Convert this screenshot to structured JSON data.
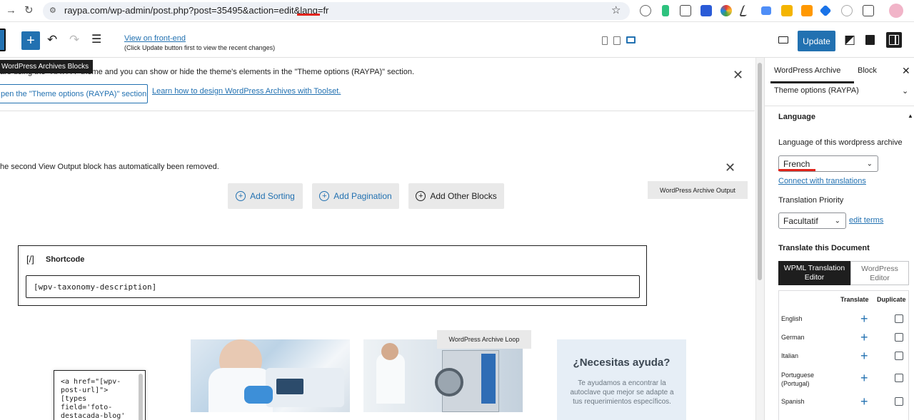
{
  "browser": {
    "url": "raypa.com/wp-admin/post.php?post=35495&action=edit&lang=fr"
  },
  "toolbar": {
    "view_front_end": "View on front-end",
    "view_hint": "(Click Update button first to view the recent changes)",
    "update_label": "Update",
    "tooltip": "WordPress Archives Blocks"
  },
  "notices": {
    "theme_text": "are using the \"RAYPA\" theme and you can show or hide the theme's elements in the \"Theme options (RAYPA)\" section.",
    "open_theme_options": "pen the \"Theme options (RAYPA)\" section",
    "learn_link": "Learn how to design WordPress Archives with Toolset.",
    "removed_text": "he second View Output block has automatically been removed."
  },
  "canvas": {
    "add_sorting": "Add Sorting",
    "add_pagination": "Add Pagination",
    "add_other": "Add Other Blocks",
    "output_label": "WordPress Archive Output",
    "loop_label": "WordPress Archive Loop",
    "shortcode_icon": "[/]",
    "shortcode_title": "Shortcode",
    "shortcode_value": "[wpv-taxonomy-description]",
    "code_snippet": "<a href=\"[wpv-\npost-url]\">\n[types\nfield='foto-\ndestacada-blog'",
    "help_title": "¿Necesitas ayuda?",
    "help_text": "Te ayudamos a encontrar la autoclave que mejor se adapte a tus requerimientos específicos."
  },
  "sidebar": {
    "tab_archive": "WordPress Archive",
    "tab_block": "Block",
    "theme_options": "Theme options (RAYPA)",
    "language_heading": "Language",
    "language_of_archive": "Language of this wordpress archive",
    "language_value": "French",
    "connect_link": "Connect with translations",
    "priority_label": "Translation Priority",
    "priority_value": "Facultatif",
    "edit_terms": "edit terms",
    "translate_doc": "Translate this Document",
    "wpml_editor_line1": "WPML Translation",
    "wpml_editor_line2": "Editor",
    "wp_editor_line1": "WordPress",
    "wp_editor_line2": "Editor",
    "col_translate": "Translate",
    "col_duplicate": "Duplicate",
    "languages": [
      "English",
      "German",
      "Italian",
      "Portuguese (Portugal)",
      "Spanish"
    ]
  },
  "colors": {
    "accent": "#2271b1",
    "underline_red": "#e2231a"
  }
}
